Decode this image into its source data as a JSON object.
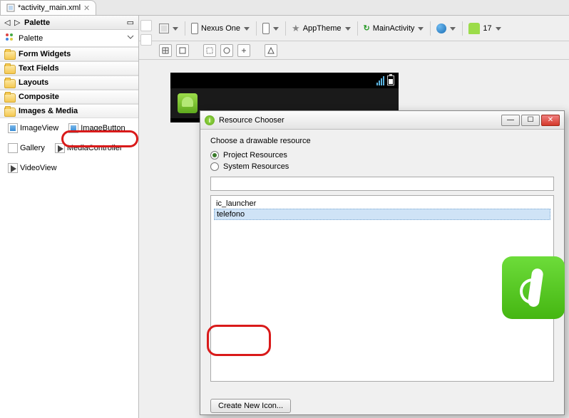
{
  "tab": {
    "label": "*activity_main.xml",
    "close": "✕"
  },
  "palette": {
    "title": "Palette",
    "sub": "Palette",
    "categories": {
      "form_widgets": "Form Widgets",
      "text_fields": "Text Fields",
      "layouts": "Layouts",
      "composite": "Composite",
      "images_media": "Images & Media"
    },
    "widgets": {
      "image_view": "ImageView",
      "image_button": "ImageButton",
      "gallery": "Gallery",
      "media_controller": "MediaController",
      "video_view": "VideoView"
    }
  },
  "toolbar": {
    "device": "Nexus One",
    "theme": "AppTheme",
    "activity": "MainActivity",
    "api": "17"
  },
  "dialog": {
    "title": "Resource Chooser",
    "prompt": "Choose a drawable resource",
    "radio_project": "Project Resources",
    "radio_system": "System Resources",
    "items": {
      "ic_launcher": "ic_launcher",
      "telefono": "telefono"
    },
    "create_btn": "Create New Icon..."
  },
  "winbtns": {
    "min": "—",
    "max": "☐",
    "close": "✕"
  }
}
